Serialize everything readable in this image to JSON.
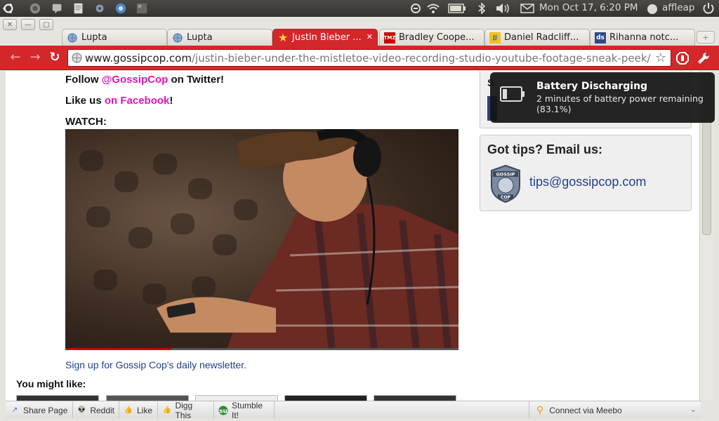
{
  "panel": {
    "clock": "Mon Oct 17,  6:20 PM",
    "user": "affleap"
  },
  "tabs": [
    {
      "label": "Lupta",
      "favicon": "globe-icon"
    },
    {
      "label": "Lupta",
      "favicon": "globe-icon"
    },
    {
      "label": "Justin Bieber ...",
      "favicon": "star-icon"
    },
    {
      "label": "Bradley Coope...",
      "favicon": "TMZ"
    },
    {
      "label": "Daniel Radcliff...",
      "favicon": "JJ"
    },
    {
      "label": "Rihanna notc...",
      "favicon": "ds"
    }
  ],
  "omnibox": {
    "domain": "www.gossipcop.com",
    "path": "/justin-bieber-under-the-mistletoe-video-recording-studio-youtube-footage-sneak-peek/"
  },
  "article": {
    "follow_prefix": "Follow ",
    "follow_link": "@GossipCop",
    "follow_suffix": " on Twitter!",
    "like_prefix": "Like us ",
    "like_link": "on Facebook",
    "like_suffix": "!",
    "watch": "WATCH:",
    "video_progress": 0.27,
    "newsletter": "Sign up for Gossip Cop's daily newsletter.",
    "you_might_like": "You might like:"
  },
  "sidebar": {
    "tips_title": "Got tips? Email us:",
    "tips_email": "tips@gossipcop.com",
    "badge_top": "GOSSIP",
    "badge_bottom": "COP",
    "partial_letter": "S"
  },
  "notification": {
    "title": "Battery Discharging",
    "body": "2 minutes of battery power remaining (83.1%)"
  },
  "sharebar": {
    "items": [
      {
        "label": "Share Page",
        "icon": "share-icon"
      },
      {
        "label": "Reddit",
        "icon": "reddit-icon"
      },
      {
        "label": "Like",
        "icon": "thumbs-up-icon"
      },
      {
        "label": "Digg This",
        "icon": "digg-icon"
      },
      {
        "label": "Stumble It!",
        "icon": "stumbleupon-icon"
      }
    ],
    "meebo": "Connect via Meebo"
  },
  "colors": {
    "toolbar": "#d4272a",
    "link_pink": "#e015b8",
    "link_blue": "#233f8a"
  }
}
